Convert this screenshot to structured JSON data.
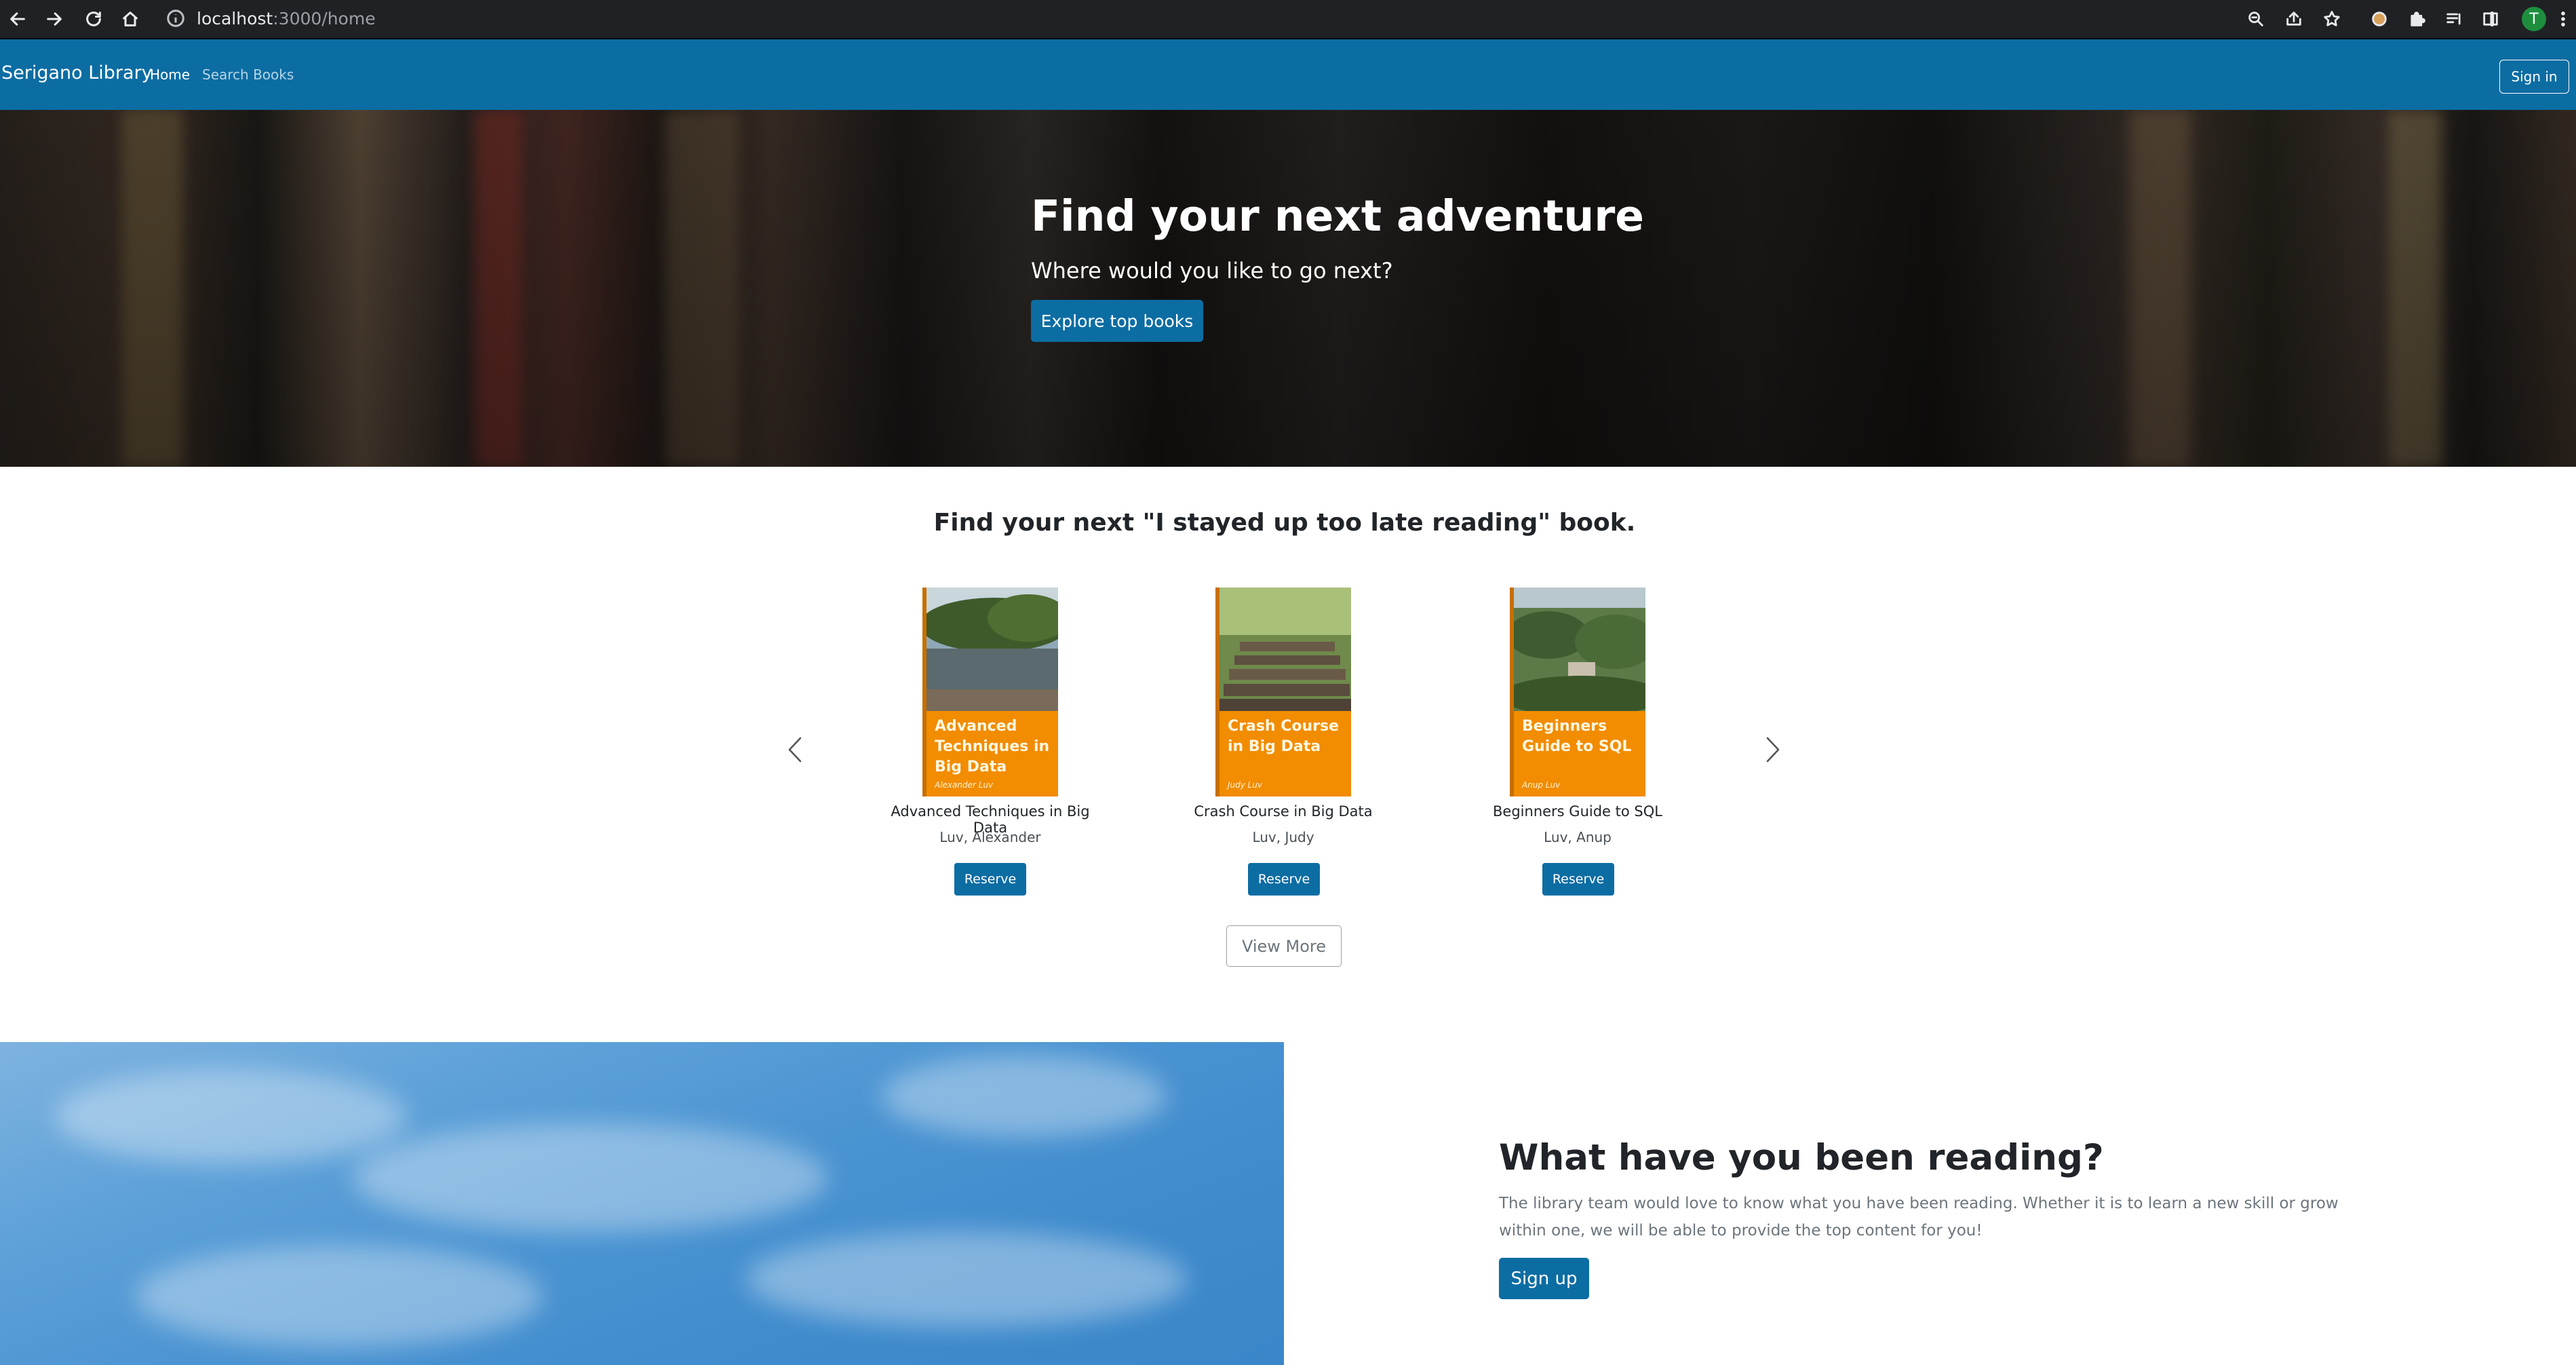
{
  "browser": {
    "url_host": "localhost",
    "url_rest": ":3000/home",
    "profile_initial": "T"
  },
  "nav": {
    "brand": "Serigano Library",
    "links": [
      {
        "label": "Home",
        "active": true
      },
      {
        "label": "Search Books",
        "active": false
      }
    ],
    "signin_label": "Sign in"
  },
  "hero": {
    "title": "Find your next adventure",
    "subtitle": "Where would you like to go next?",
    "cta_label": "Explore top books"
  },
  "featured": {
    "heading": "Find your next \"I stayed up too late reading\" book.",
    "books": [
      {
        "cover_title": "Advanced Techniques in Big Data",
        "cover_author": "Alexander Luv",
        "title": "Advanced Techniques in Big Data",
        "author": "Luv, Alexander",
        "reserve_label": "Reserve"
      },
      {
        "cover_title": "Crash Course in Big Data",
        "cover_author": "Judy Luv",
        "title": "Crash Course in Big Data",
        "author": "Luv, Judy",
        "reserve_label": "Reserve"
      },
      {
        "cover_title": "Beginners Guide to SQL",
        "cover_author": "Anup Luv",
        "title": "Beginners Guide to SQL",
        "author": "Luv, Anup",
        "reserve_label": "Reserve"
      }
    ],
    "view_more_label": "View More"
  },
  "reading": {
    "title": "What have you been reading?",
    "text": "The library team would love to know what you have been reading. Whether it is to learn a new skill or grow within one, we will be able to provide the top content for you!",
    "signup_label": "Sign up"
  },
  "colors": {
    "primary": "#0c6da3",
    "cover_orange": "#f28c00",
    "browser_chrome": "#202124"
  }
}
